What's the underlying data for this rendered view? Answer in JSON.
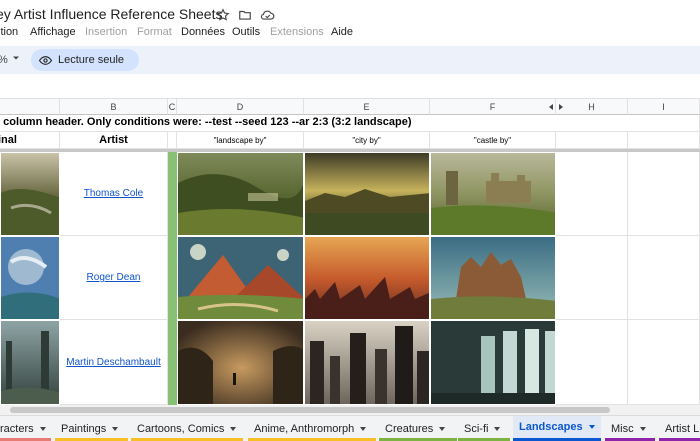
{
  "doc": {
    "title": "ey Artist Influence Reference Sheets"
  },
  "menu": {
    "items": [
      {
        "label": "ition",
        "disabled": false
      },
      {
        "label": "Affichage",
        "disabled": false
      },
      {
        "label": "Insertion",
        "disabled": true
      },
      {
        "label": "Format",
        "disabled": true
      },
      {
        "label": "Données",
        "disabled": false
      },
      {
        "label": "Outils",
        "disabled": false
      },
      {
        "label": "Extensions",
        "disabled": true
      },
      {
        "label": "Aide",
        "disabled": false
      }
    ]
  },
  "toolbar": {
    "zoom": "%",
    "readonly_label": "Lecture seule"
  },
  "grid": {
    "columns": [
      "B",
      "C",
      "D",
      "E",
      "F",
      "H",
      "I"
    ],
    "note": "e column header. Only conditions were:  --test --seed 123 --ar 2:3 (3:2 landscape)",
    "header_row": {
      "original": "inal",
      "artist": "Artist",
      "d": "\"landscape by\"",
      "e": "\"city by\"",
      "f": "\"castle by\""
    },
    "rows": [
      {
        "artist": "Thomas Cole"
      },
      {
        "artist": "Roger Dean"
      },
      {
        "artist": "Martin Deschambault"
      }
    ]
  },
  "tabs": [
    {
      "label": "racters",
      "color": "#e67c73"
    },
    {
      "label": "Paintings",
      "color": "#f6bf26"
    },
    {
      "label": "Cartoons, Comics",
      "color": "#f6bf26"
    },
    {
      "label": "Anime, Anthromorph",
      "color": "#f6bf26"
    },
    {
      "label": "Creatures",
      "color": "#7cb342"
    },
    {
      "label": "Sci-fi",
      "color": "#7cb342"
    },
    {
      "label": "Landscapes",
      "color": "#0b57d0"
    },
    {
      "label": "Misc",
      "color": "#8e24aa"
    },
    {
      "label": "Artist L",
      "color": "#8e24aa"
    }
  ]
}
